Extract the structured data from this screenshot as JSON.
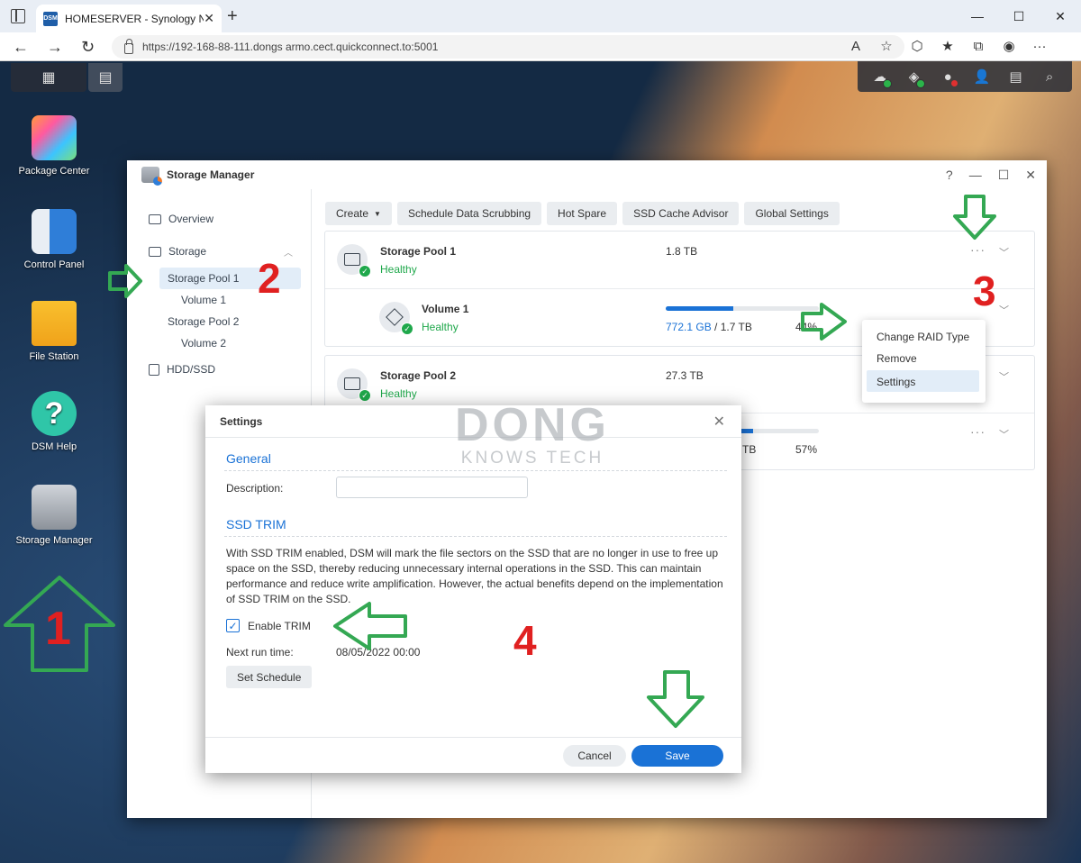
{
  "browser": {
    "tab_title": "HOMESERVER - Synology NAS",
    "favicon_text": "DSM",
    "url": "https://192-168-88-111.dongs ar​m​o.cect.quickconnect.to:5001",
    "new_tab": "+",
    "minimize": "—",
    "maximize": "☐",
    "close": "✕"
  },
  "desktop": {
    "icons": [
      {
        "label": "Package Center"
      },
      {
        "label": "Control Panel"
      },
      {
        "label": "File Station"
      },
      {
        "label": "DSM Help"
      },
      {
        "label": "Storage Manager"
      }
    ]
  },
  "storage_manager": {
    "title": "Storage Manager",
    "sidebar": {
      "overview": "Overview",
      "storage": "Storage",
      "pool1": "Storage Pool 1",
      "volume1": "Volume 1",
      "pool2": "Storage Pool 2",
      "volume2": "Volume 2",
      "hdd": "HDD/SSD"
    },
    "toolbar": {
      "create": "Create",
      "scrub": "Schedule Data Scrubbing",
      "hot_spare": "Hot Spare",
      "ssd_cache": "SSD Cache Advisor",
      "global": "Global Settings"
    },
    "pool1": {
      "name": "Storage Pool 1",
      "status": "Healthy",
      "size": "1.8 TB"
    },
    "volume1": {
      "name": "Volume 1",
      "status": "Healthy",
      "used": "772.1 GB",
      "total": " / 1.7 TB",
      "percent": "44%",
      "fill": 0.44
    },
    "pool2": {
      "name": "Storage Pool 2",
      "status": "Healthy",
      "size": "27.3 TB"
    },
    "volume2": {
      "total_tail": "TB",
      "percent": "57%",
      "fill": 0.57
    },
    "context_menu": [
      "Change RAID Type",
      "Remove",
      "Settings"
    ]
  },
  "dialog": {
    "title": "Settings",
    "general": "General",
    "description_label": "Description:",
    "description_value": "",
    "ssd_trim": "SSD TRIM",
    "paragraph": "With SSD TRIM enabled, DSM will mark the file sectors on the SSD that are no longer in use to free up space on the SSD, thereby reducing unnecessary internal operations in the SSD. This can maintain performance and reduce write amplification. However, the actual benefits depend on the implementation of SSD TRIM on the SSD.",
    "enable_trim": "Enable TRIM",
    "enable_trim_checked": true,
    "next_run_label": "Next run time:",
    "next_run_value": "08/05/2022 00:00",
    "set_schedule": "Set Schedule",
    "cancel": "Cancel",
    "save": "Save"
  },
  "annotations": {
    "n1": "1",
    "n2": "2",
    "n3": "3",
    "n4": "4"
  },
  "watermark": {
    "line1": "DONG",
    "line2": "KNOWS TECH"
  },
  "colors": {
    "accent": "#1a72d6",
    "healthy": "#1fa84b",
    "annotation_green": "#34a853",
    "annotation_red": "#e02020"
  }
}
